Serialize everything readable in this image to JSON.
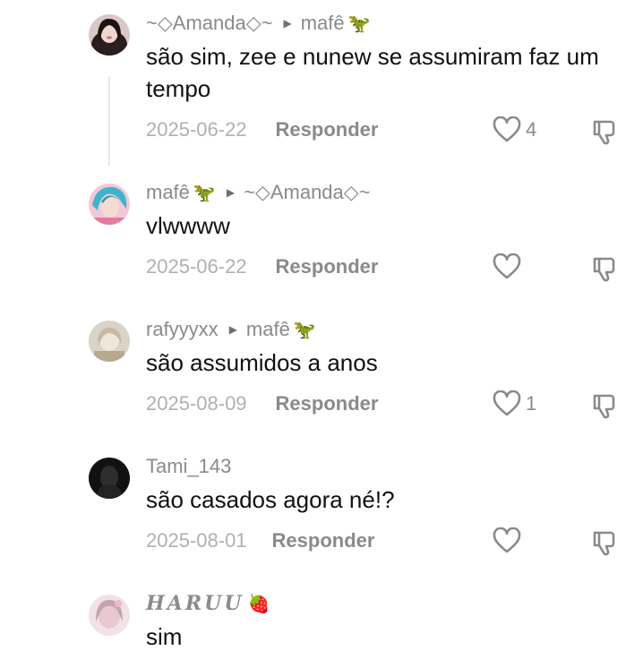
{
  "comments": [
    {
      "author": "~◇Amanda◇~",
      "reply_to": "mafê",
      "reply_to_emoji": "🦖",
      "text": "são sim, zee e nunew se assumiram faz um tempo",
      "date": "2025-06-22",
      "reply_label": "Responder",
      "likes": "4"
    },
    {
      "author": "mafê",
      "author_emoji": "🦖",
      "reply_to": "~◇Amanda◇~",
      "text": "vlwwww",
      "date": "2025-06-22",
      "reply_label": "Responder"
    },
    {
      "author": "rafyyyxx",
      "reply_to": "mafê",
      "reply_to_emoji": "🦖",
      "text": "são assumidos a anos",
      "date": "2025-08-09",
      "reply_label": "Responder",
      "likes": "1"
    },
    {
      "author": "Tami_143",
      "text": "são casados agora né!?",
      "date": "2025-08-01",
      "reply_label": "Responder"
    },
    {
      "author": "HARUU",
      "author_emoji": "🍓",
      "text": "sim"
    }
  ],
  "icons": {
    "reply_arrow": "play-triangle-icon",
    "like": "heart-outline-icon",
    "dislike": "thumbs-down-icon"
  },
  "colors": {
    "author": "#8a8a8a",
    "text": "#111111",
    "date": "#b0b0b0",
    "icon": "#8a8a8a",
    "thread_line": "#e6e6e6"
  }
}
